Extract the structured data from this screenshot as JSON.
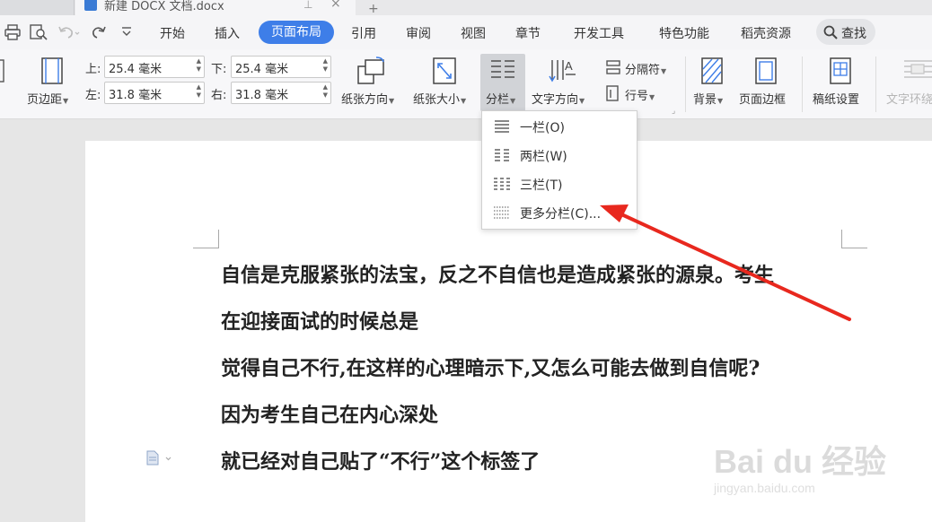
{
  "titlebar": {
    "doc_tab_title": "新建 DOCX 文档.docx",
    "new_tab": "+"
  },
  "menu": {
    "items": [
      "开始",
      "插入",
      "页面布局",
      "引用",
      "审阅",
      "视图",
      "章节",
      "开发工具",
      "特色功能",
      "稻壳资源"
    ],
    "active": "页面布局",
    "find_label": "查找"
  },
  "ribbon": {
    "margins_label": "页边距",
    "top_label": "上:",
    "top_value": "25.4 毫米",
    "bottom_label": "下:",
    "bottom_value": "25.4 毫米",
    "left_label": "左:",
    "left_value": "31.8 毫米",
    "right_label": "右:",
    "right_value": "31.8 毫米",
    "orientation_label": "纸张方向",
    "size_label": "纸张大小",
    "columns_label": "分栏",
    "text_direction_label": "文字方向",
    "separator_label": "分隔符",
    "line_number_label": "行号",
    "background_label": "背景",
    "page_border_label": "页面边框",
    "manuscript_label": "稿纸设置",
    "text_wrap_label": "文字环绕"
  },
  "columns_menu": {
    "items": [
      {
        "label": "一栏(O)",
        "icon": "one-column-icon"
      },
      {
        "label": "两栏(W)",
        "icon": "two-column-icon"
      },
      {
        "label": "三栏(T)",
        "icon": "three-column-icon"
      },
      {
        "label": "更多分栏(C)...",
        "icon": "more-columns-icon"
      }
    ]
  },
  "document": {
    "lines": [
      "自信是克服紧张的法宝，反之不自信也是造成紧张的源泉。考生",
      "在迎接面试的时候总是",
      "觉得自己不行,在这样的心理暗示下,又怎么可能去做到自信呢?",
      "因为考生自己在内心深处",
      "就已经对自己贴了“不行”这个标签了"
    ]
  },
  "watermark": {
    "brand": "Bai du 经验",
    "url": "jingyan.baidu.com"
  },
  "colors": {
    "accent": "#3e7ee8",
    "annotation_arrow": "#e8281e"
  }
}
